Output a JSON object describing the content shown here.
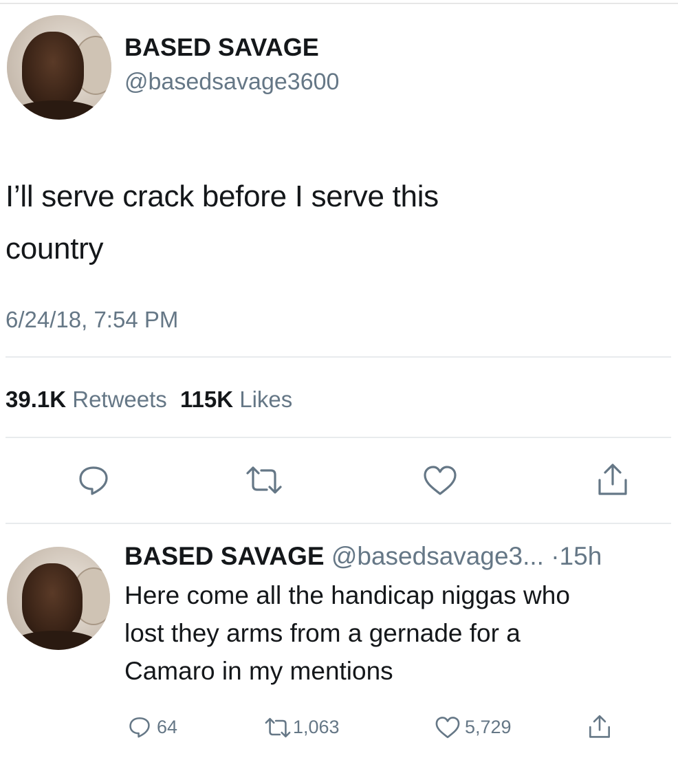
{
  "tweet": {
    "display_name": "BASED SAVAGE",
    "handle": "@basedsavage3600",
    "text": "I’ll serve crack before I serve this\ncountry",
    "timestamp": "6/24/18, 7:54 PM",
    "retweets_count": "39.1K",
    "retweets_label": "Retweets",
    "likes_count": "115K",
    "likes_label": "Likes",
    "actions": [
      "reply-icon",
      "retweet-icon",
      "like-icon",
      "share-icon"
    ]
  },
  "reply": {
    "display_name": "BASED SAVAGE",
    "handle": "@basedsavage3...",
    "time": "·15h",
    "text": "Here come all the handicap niggas who\nlost they arms from a gernade for a\nCamaro in my mentions",
    "replies": "64",
    "retweets": "1,063",
    "likes": "5,729"
  },
  "colors": {
    "text": "#14171a",
    "muted": "#657786",
    "divider": "#e8ebed"
  }
}
